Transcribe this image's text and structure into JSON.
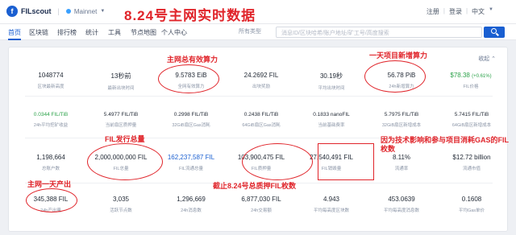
{
  "header": {
    "logo": "FILscout",
    "network": "Mainnet",
    "overlay_title": "8.24号主网实时数据",
    "links": [
      "注册",
      "登录",
      "中文"
    ]
  },
  "nav": {
    "items": [
      "首页",
      "区块链",
      "排行榜",
      "统计",
      "工具",
      "节点地图",
      "个人中心"
    ],
    "active": "首页",
    "filter_select": "所有类型",
    "search_placeholder": "消息ID/区块哈希/账户地址/矿工号/高度搜索"
  },
  "panel": {
    "collapse_label": "收起",
    "rows": [
      [
        {
          "value": "1048774",
          "label": "区块最新高度"
        },
        {
          "value": "13秒前",
          "label": "最新出块时间"
        },
        {
          "value": "9.5783 EiB",
          "label": "全网有效算力"
        },
        {
          "value": "24.2692 FIL",
          "label": "出块奖励"
        },
        {
          "value": "30.19秒",
          "label": "平均出块时间"
        },
        {
          "value": "56.78 PiB",
          "label": "24h新增算力"
        },
        {
          "value": "$78.38",
          "value_extra": "(+0.61%)",
          "label": "FIL价格"
        }
      ],
      [
        {
          "value": "0.0344 FIL/TiB",
          "label": "24h平均挖矿收益"
        },
        {
          "value": "5.4977 FIL/TiB",
          "label": "当前扇区质押量"
        },
        {
          "value": "0.2998 FIL/TiB",
          "label": "32GiB扇区Gas消耗"
        },
        {
          "value": "0.2438 FIL/TiB",
          "label": "64GiB扇区Gas消耗"
        },
        {
          "value": "0.1833 nanoFIL",
          "label": "当前基础费率"
        },
        {
          "value": "5.7975 FIL/TiB",
          "label": "32GiB扇区新增成本"
        },
        {
          "value": "5.7415 FIL/TiB",
          "label": "64GiB扇区新增成本"
        }
      ],
      [
        {
          "value": "1,198,664",
          "label": "总账户数"
        },
        {
          "value": "2,000,000,000 FIL",
          "label": "FIL总量"
        },
        {
          "value": "162,237,587 FIL",
          "label": "FIL流通总量"
        },
        {
          "value": "103,900,475 FIL",
          "label": "FIL质押量"
        },
        {
          "value": "27,540,491 FIL",
          "label": "FIL销毁量"
        },
        {
          "value": "8.11%",
          "label": "流通率"
        },
        {
          "value": "$12.72 billion",
          "label": "流通市值"
        }
      ],
      [
        {
          "value": "345,388 FIL",
          "label": "24h产出量"
        },
        {
          "value": "3,035",
          "label": "活跃节点数"
        },
        {
          "value": "1,296,669",
          "label": "24h消息数"
        },
        {
          "value": "6,877,030 FIL",
          "label": "24h交易额"
        },
        {
          "value": "4.943",
          "label": "平均每高度区块数"
        },
        {
          "value": "453.0639",
          "label": "平均每高度消息数"
        },
        {
          "value": "0.1608",
          "label": "平均Gas单价"
        }
      ]
    ]
  },
  "annotations": {
    "total_power": "主网总有效算力",
    "daily_new_power": "一天项目新增算力",
    "fil_supply": "FIL发行总量",
    "burn_note": "因为技术影响和参与项目消耗GAS的FIL枚数",
    "daily_output": "主网一天产出",
    "pledge_note": "截止8.24号总质押FIL枚数"
  }
}
